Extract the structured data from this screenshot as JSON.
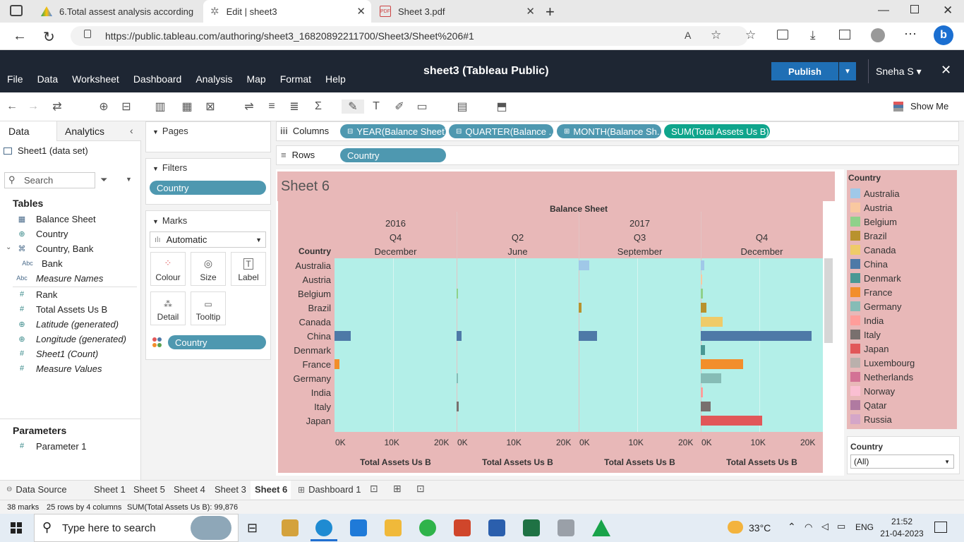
{
  "browser": {
    "tabs": [
      {
        "title": "6.Total assest analysis according"
      },
      {
        "title": "Edit | sheet3"
      },
      {
        "title": "Sheet 3.pdf"
      }
    ],
    "url": "https://public.tableau.com/authoring/sheet3_16820892211700/Sheet3/Sheet%206#1"
  },
  "app": {
    "title": "sheet3 (Tableau Public)",
    "menu": [
      "File",
      "Data",
      "Worksheet",
      "Dashboard",
      "Analysis",
      "Map",
      "Format",
      "Help"
    ],
    "publish": "Publish",
    "user": "Sneha S",
    "show_me": "Show Me"
  },
  "left": {
    "tab_data": "Data",
    "tab_analytics": "Analytics",
    "datasource": "Sheet1 (data set)",
    "search_placeholder": "Search",
    "tables_label": "Tables",
    "fields": [
      "Balance Sheet",
      "Country",
      "Country, Bank",
      "Bank",
      "Measure Names",
      "Rank",
      "Total Assets Us B",
      "Latitude (generated)",
      "Longitude (generated)",
      "Sheet1 (Count)",
      "Measure Values"
    ],
    "parameters_label": "Parameters",
    "parameter": "Parameter 1"
  },
  "cards": {
    "pages": "Pages",
    "filters": "Filters",
    "filter_pill": "Country",
    "marks": "Marks",
    "mark_type": "Automatic",
    "buttons": [
      "Colour",
      "Size",
      "Label",
      "Detail",
      "Tooltip"
    ],
    "color_pill": "Country"
  },
  "shelves": {
    "columns_label": "Columns",
    "rows_label": "Rows",
    "columns": [
      "YEAR(Balance Sheet)",
      "QUARTER(Balance ...",
      "MONTH(Balance Sh...",
      "SUM(Total Assets Us B)"
    ],
    "rows": [
      "Country"
    ]
  },
  "viz": {
    "sheet_title": "Sheet 6",
    "top_header": "Balance Sheet",
    "row_header": "Country",
    "years": [
      "2016",
      "2017"
    ],
    "quarters": [
      "Q4",
      "Q2",
      "Q3",
      "Q4"
    ],
    "months": [
      "December",
      "June",
      "September",
      "December"
    ],
    "axis_ticks": [
      "0K",
      "10K",
      "20K"
    ],
    "axis_title": "Total Assets Us B"
  },
  "chart_data": {
    "type": "bar",
    "xlabel": "Total Assets Us B",
    "xlim": [
      0,
      20000
    ],
    "panels": [
      "2016 Q4 December",
      "2017 Q2 June",
      "2017 Q3 September",
      "2017 Q4 December"
    ],
    "categories": [
      "Australia",
      "Austria",
      "Belgium",
      "Brazil",
      "Canada",
      "China",
      "Denmark",
      "France",
      "Germany",
      "India",
      "Italy",
      "Japan"
    ],
    "series": [
      {
        "values": [
          0,
          0,
          0,
          0,
          0,
          2800,
          0,
          800,
          0,
          0,
          0,
          0
        ]
      },
      {
        "values": [
          0,
          0,
          150,
          0,
          0,
          900,
          0,
          0,
          100,
          0,
          350,
          0
        ]
      },
      {
        "values": [
          1800,
          0,
          0,
          450,
          0,
          3100,
          0,
          0,
          0,
          0,
          0,
          0
        ]
      },
      {
        "values": [
          600,
          100,
          400,
          1000,
          3800,
          19000,
          700,
          7300,
          3500,
          350,
          1700,
          10500
        ]
      }
    ],
    "colors": [
      "#a0c8e8",
      "#f9c8a0",
      "#8fd18a",
      "#b8922e",
      "#efcb68",
      "#4e79a7",
      "#499894",
      "#f28e2b",
      "#86bcb6",
      "#ff9d9a",
      "#79706e",
      "#e15759"
    ]
  },
  "legend": {
    "title": "Country",
    "items": [
      "Australia",
      "Austria",
      "Belgium",
      "Brazil",
      "Canada",
      "China",
      "Denmark",
      "France",
      "Germany",
      "India",
      "Italy",
      "Japan",
      "Luxembourg",
      "Netherlands",
      "Norway",
      "Qatar",
      "Russia"
    ],
    "colors": [
      "#a0c8e8",
      "#f9c8a0",
      "#8fd18a",
      "#b8922e",
      "#efcb68",
      "#4e79a7",
      "#499894",
      "#f28e2b",
      "#86bcb6",
      "#ff9d9a",
      "#79706e",
      "#e15759",
      "#bab0ac",
      "#d37295",
      "#fabfd2",
      "#b07aa1",
      "#d4a6c8"
    ],
    "filter_title": "Country",
    "filter_value": "(All)"
  },
  "bottom": {
    "data_source": "Data Source",
    "sheets": [
      "Sheet 1",
      "Sheet 5",
      "Sheet 4",
      "Sheet 3",
      "Sheet 6",
      "Dashboard 1"
    ],
    "status": [
      "38 marks",
      "25 rows by 4 columns",
      "SUM(Total Assets Us B): 99,876"
    ]
  },
  "taskbar": {
    "search": "Type here to search",
    "weather": "33°C",
    "lang": "ENG",
    "time": "21:52",
    "date": "21-04-2023"
  }
}
